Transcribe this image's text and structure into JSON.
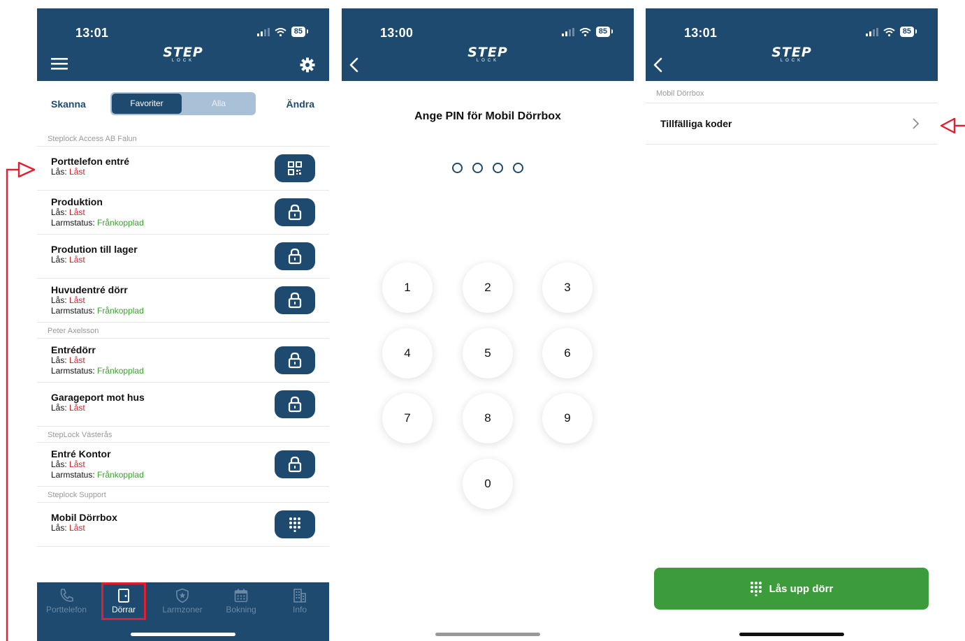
{
  "colors": {
    "navy": "#1d4a6e",
    "red": "#d0202a",
    "green": "#3aa22e",
    "annotation": "#e02030"
  },
  "screen1": {
    "time": "13:01",
    "battery": "85",
    "logo": {
      "main": "STEP",
      "sub": "LOCK"
    },
    "segment": {
      "left": "Skanna",
      "fav": "Favoriter",
      "all": "Alla",
      "right": "Ändra"
    },
    "sections": [
      {
        "title": "Steplock Access AB Falun",
        "items": [
          {
            "name": "Porttelefon entré",
            "lock_label": "Lås:",
            "lock_value": "Låst",
            "alarm_label": "",
            "alarm_value": "",
            "icon": "qr-icon"
          },
          {
            "name": "Produktion",
            "lock_label": "Lås:",
            "lock_value": "Låst",
            "alarm_label": "Larmstatus:",
            "alarm_value": "Frånkopplad",
            "icon": "lock-icon"
          },
          {
            "name": "Prodution till lager",
            "lock_label": "Lås:",
            "lock_value": "Låst",
            "alarm_label": "",
            "alarm_value": "",
            "icon": "lock-icon"
          },
          {
            "name": "Huvudentré dörr",
            "lock_label": "Lås:",
            "lock_value": "Låst",
            "alarm_label": "Larmstatus:",
            "alarm_value": "Frånkopplad",
            "icon": "lock-icon"
          }
        ]
      },
      {
        "title": "Peter Axelsson",
        "items": [
          {
            "name": "Entrédörr",
            "lock_label": "Lås:",
            "lock_value": "Låst",
            "alarm_label": "Larmstatus:",
            "alarm_value": "Frånkopplad",
            "icon": "lock-icon"
          },
          {
            "name": "Garageport mot hus",
            "lock_label": "Lås:",
            "lock_value": "Låst",
            "alarm_label": "",
            "alarm_value": "",
            "icon": "lock-icon"
          }
        ]
      },
      {
        "title": "StepLock Västerås",
        "items": [
          {
            "name": "Entré Kontor",
            "lock_label": "Lås:",
            "lock_value": "Låst",
            "alarm_label": "Larmstatus:",
            "alarm_value": "Frånkopplad",
            "icon": "lock-icon"
          }
        ]
      },
      {
        "title": "Steplock Support",
        "items": [
          {
            "name": "Mobil Dörrbox",
            "lock_label": "Lås:",
            "lock_value": "Låst",
            "alarm_label": "",
            "alarm_value": "",
            "icon": "keypad-icon"
          }
        ]
      }
    ],
    "tabs": [
      {
        "label": "Porttelefon",
        "icon": "phone-icon"
      },
      {
        "label": "Dörrar",
        "icon": "door-icon",
        "active": true
      },
      {
        "label": "Larmzoner",
        "icon": "shield-icon"
      },
      {
        "label": "Bokning",
        "icon": "calendar-icon"
      },
      {
        "label": "Info",
        "icon": "building-icon"
      }
    ]
  },
  "screen2": {
    "time": "13:00",
    "battery": "85",
    "logo": {
      "main": "STEP",
      "sub": "LOCK"
    },
    "title": "Ange PIN för Mobil Dörrbox",
    "keys": [
      "1",
      "2",
      "3",
      "4",
      "5",
      "6",
      "7",
      "8",
      "9",
      "0"
    ]
  },
  "screen3": {
    "time": "13:01",
    "battery": "85",
    "logo": {
      "main": "STEP",
      "sub": "LOCK"
    },
    "section": "Mobil Dörrbox",
    "row": "Tillfälliga koder",
    "button": "Lås upp dörr"
  }
}
